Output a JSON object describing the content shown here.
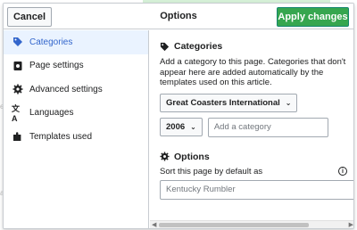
{
  "dialog": {
    "title": "Options",
    "cancel_label": "Cancel",
    "apply_label": "Apply changes"
  },
  "menu": {
    "items": [
      {
        "label": "Categories",
        "icon": "tag-icon",
        "selected": true
      },
      {
        "label": "Page settings",
        "icon": "page-settings-icon",
        "selected": false
      },
      {
        "label": "Advanced settings",
        "icon": "gear-icon",
        "selected": false
      },
      {
        "label": "Languages",
        "icon": "language-icon",
        "selected": false
      },
      {
        "label": "Templates used",
        "icon": "puzzle-icon",
        "selected": false
      }
    ]
  },
  "categories": {
    "heading": "Categories",
    "help": "Add a category to this page. Categories that don't appear here are added automatically by the templates used on this article.",
    "existing_category": "Great Coasters International",
    "year_value": "2006",
    "add_placeholder": "Add a category"
  },
  "options": {
    "heading": "Options",
    "sort_label": "Sort this page by default as",
    "sort_placeholder": "Kentucky Rumbler"
  },
  "colors": {
    "accent": "#36c",
    "apply_bg": "#36a64f",
    "selected_bg": "#eaf3ff",
    "border": "#c8ccd1"
  }
}
